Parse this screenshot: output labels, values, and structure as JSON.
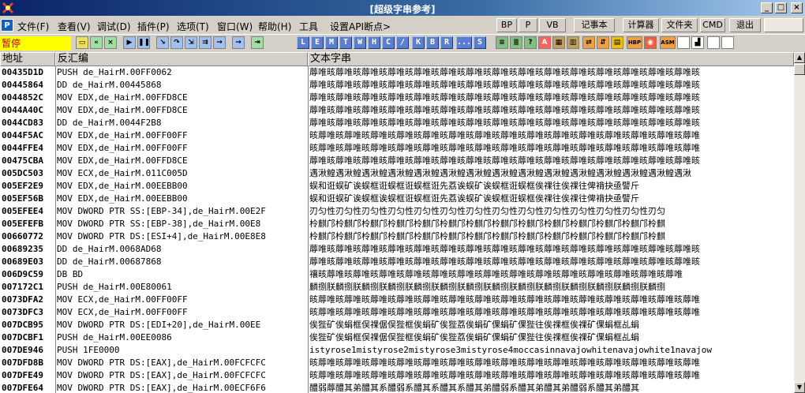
{
  "window": {
    "title": "[超级字串参考]",
    "minimize": "_",
    "maximize": "□",
    "close": "×"
  },
  "menu": {
    "items": [
      "文件(F)",
      "查看(V)",
      "调试(D)",
      "插件(P)",
      "选项(T)",
      "窗口(W)",
      "帮助(H)",
      "工具",
      "设置API断点>"
    ],
    "buttons": [
      "BP",
      "P",
      "VB",
      "记事本",
      "计算器",
      "文件夹",
      "CMD",
      "退出"
    ]
  },
  "toolbar": {
    "status": "暂停",
    "letters": [
      "L",
      "E",
      "M",
      "T",
      "W",
      "H",
      "C",
      "/",
      "K",
      "B",
      "R",
      "...",
      "S"
    ],
    "extra_labels": [
      "HBP",
      "ASM"
    ]
  },
  "table": {
    "headers": [
      "地址",
      "反汇编",
      "文本字串"
    ],
    "rows": [
      {
        "addr": "00435D1D",
        "dis": "PUSH de_HairM.00FF0062",
        "str": "蓐唯晐蓐唯晐蓐唯晐蓐唯晐蓐唯晐蓐唯晐蓐唯晐蓐唯晐蓐唯晐蓐唯晐蓐唯晐蓐唯晐蓐唯晐蓐唯晐蓐唯晐"
      },
      {
        "addr": "00445864",
        "dis": "DD de_HairM.00445868",
        "str": "蓐唯晐蓐唯晐蓐唯晐蓐唯晐蓐唯晐蓐唯晐蓐唯晐蓐唯晐蓐唯晐蓐唯晐蓐唯晐蓐唯晐蓐唯晐蓐唯晐蓐唯晐"
      },
      {
        "addr": "0044852C",
        "dis": "MOV EDX,de_HairM.00FFD8CE",
        "str": "蓐唯晐蓐唯晐蓐唯晐蓐唯晐蓐唯晐蓐唯晐蓐唯晐蓐唯晐蓐唯晐蓐唯晐蓐唯晐蓐唯晐蓐唯晐蓐唯晐蓐唯晐"
      },
      {
        "addr": "0044A40C",
        "dis": "MOV EDX,de_HairM.00FFD8CE",
        "str": "蓐唯晐蓐唯晐蓐唯晐蓐唯晐蓐唯晐蓐唯晐蓐唯晐蓐唯晐蓐唯晐蓐唯晐蓐唯晐蓐唯晐蓐唯晐蓐唯晐蓐唯晐"
      },
      {
        "addr": "0044CD83",
        "dis": "DD de_HairM.0044F2B8",
        "str": "蓐唯晐蓐唯晐蓐唯晐蓐唯晐蓐唯晐蓐唯晐蓐唯晐蓐唯晐蓐唯晐蓐唯晐蓐唯晐蓐唯晐蓐唯晐蓐唯晐蓐唯晐"
      },
      {
        "addr": "0044F5AC",
        "dis": "MOV EDX,de_HairM.00FF00FF",
        "str": "晐蓐唯晐蓐唯晐蓐唯晐蓐唯晐蓐唯晐蓐唯晐蓐唯晐蓐唯晐蓐唯晐蓐唯晐蓐唯晐蓐唯晐蓐唯晐蓐唯晐蓐唯"
      },
      {
        "addr": "0044FFE4",
        "dis": "MOV EDX,de_HairM.00FF00FF",
        "str": "晐蓐唯晐蓐唯晐蓐唯晐蓐唯晐蓐唯晐蓐唯晐蓐唯晐蓐唯晐蓐唯晐蓐唯晐蓐唯晐蓐唯晐蓐唯晐蓐唯晐蓐唯"
      },
      {
        "addr": "00475CBA",
        "dis": "MOV EDX,de_HairM.00FFD8CE",
        "str": "蓐唯晐蓐唯晐蓐唯晐蓐唯晐蓐唯晐蓐唯晐蓐唯晐蓐唯晐蓐唯晐蓐唯晐蓐唯晐蓐唯晐蓐唯晐蓐唯晐蓐唯晐"
      },
      {
        "addr": "005DC503",
        "dis": "MOV ECX,de_HairM.011C005D",
        "str": "遇湫鳇遇湫鳇遇湫鳇遇湫鳇遇湫鳇遇湫鳇遇湫鳇遇湫鳇遇湫鳇遇湫鳇遇湫鳇遇湫鳇遇湫鳇遇湫鳇遇湫"
      },
      {
        "addr": "005EF2E9",
        "dis": "MOV EDX,de_HairM.00EEBB00",
        "str": "蜈和诳蜈矿诶蜈框诳蜈框诳蜈框诳先荔诶蜈矿诶蜈框诳蜈框俟祼往俟祼往俾褙抉亟譬斤"
      },
      {
        "addr": "005EF56B",
        "dis": "MOV EDX,de_HairM.00EEBB00",
        "str": "蜈和诳蜈矿诶蜈框诶蜈框诳蜈框诳先荔诶蜈矿诶蜈框诳蜈框俟祼往俟祼往俾褙抉亟譬斤"
      },
      {
        "addr": "005EFEE4",
        "dis": "MOV DWORD PTR SS:[EBP-34],de_HairM.00E2F",
        "str": "刃匀性刃匀性刃匀性刃匀性刃匀性刃匀性刃匀性刃匀性刃匀性刃匀性刃匀性刃匀性刃匀性刃匀"
      },
      {
        "addr": "005EFEFB",
        "dis": "MOV DWORD PTR SS:[EBP-38],de_HairM.00E8",
        "str": "柃麒邝柃麒邝柃麒邝柃麒邝柃麒邝柃麒邝柃麒邝柃麒邝柃麒邝柃麒邝柃麒邝柃麒邝柃麒邝柃麒"
      },
      {
        "addr": "00660772",
        "dis": "MOV DWORD PTR DS:[ESI+4],de_HairM.00E8E8",
        "str": "柃麒邝柃麒邝柃麒邝柃麒邝柃麒邝柃麒邝柃麒邝柃麒邝柃麒邝柃麒邝柃麒邝柃麒邝柃麒邝柃麒"
      },
      {
        "addr": "00689235",
        "dis": "DD de_HairM.0068AD68",
        "str": "蓐唯晐蓐唯晐蓐唯晐蓐唯晐蓐唯晐蓐唯晐蓐唯晐蓐唯晐蓐唯晐蓐唯晐蓐唯晐蓐唯晐蓐唯晐蓐唯晐蓐唯晐"
      },
      {
        "addr": "00689E03",
        "dis": "DD de_HairM.00687868",
        "str": "蓐唯晐蓐唯晐蓐唯晐蓐唯晐蓐唯晐蓐唯晐蓐唯晐蓐唯晐蓐唯晐蓐唯晐蓐唯晐蓐唯晐蓐唯晐蓐唯晐蓐唯晐"
      },
      {
        "addr": "006D9C59",
        "dis": "DB BD",
        "str": "禳晐蓐唯晐蓐唯晐蓐唯晐蓐唯晐蓐唯晐蓐唯晐蓐唯晐蓐唯晐蓐唯晐蓐唯晐蓐唯晐蓐唯晐蓐唯晐蓐唯"
      },
      {
        "addr": "007172C1",
        "dis": "PUSH de_HairM.00E80061",
        "str": "麟捌朕麟捌朕麟捌朕麟捌朕麟捌朕麟捌朕麟捌朕麟捌朕麟捌朕麟捌朕麟捌朕麟捌朕麟捌朕麟捌"
      },
      {
        "addr": "0073DFA2",
        "dis": "MOV ECX,de_HairM.00FF00FF",
        "str": "晐蓐唯晐蓐唯晐蓐唯晐蓐唯晐蓐唯晐蓐唯晐蓐唯晐蓐唯晐蓐唯晐蓐唯晐蓐唯晐蓐唯晐蓐唯晐蓐唯晐蓐唯"
      },
      {
        "addr": "0073DFC3",
        "dis": "MOV ECX,de_HairM.00FF00FF",
        "str": "晐蓐唯晐蓐唯晐蓐唯晐蓐唯晐蓐唯晐蓐唯晐蓐唯晐蓐唯晐蓐唯晐蓐唯晐蓐唯晐蓐唯晐蓐唯晐蓐唯晐蓐唯"
      },
      {
        "addr": "007DCB95",
        "dis": "MOV DWORD PTR DS:[EDI+20],de_HairM.00EE",
        "str": "俟狴矿俟蜎框俣祼倨俣狴框俟蜎矿俟狴荔俟蜎矿倮蜎矿倮狴往俟祼框俟祼矿倮蜎框乩蜎"
      },
      {
        "addr": "007DCBF1",
        "dis": "PUSH de_HairM.00EE0086",
        "str": "俟狴矿俟蜎框俣祼倨俣狴框俟蜎矿俟狴荔俟蜎矿倮蜎矿倮狴往俟祼框俟祼矿倮蜎框乩蜎"
      },
      {
        "addr": "007DE946",
        "dis": "PUSH 1FE0000",
        "str": "istyrose1mistyrose2mistyrose3mistyrose4moccasinnavajowhitenavajowhite1navajow"
      },
      {
        "addr": "007DFD8B",
        "dis": "MOV DWORD PTR DS:[EAX],de_HairM.00FCFCFC",
        "str": "晐蓐唯晐蓐唯晐蓐唯晐蓐唯晐蓐唯晐蓐唯晐蓐唯晐蓐唯晐蓐唯晐蓐唯晐蓐唯晐蓐唯晐蓐唯晐蓐唯晐蓐唯"
      },
      {
        "addr": "007DFE49",
        "dis": "MOV DWORD PTR DS:[EAX],de_HairM.00FCFCFC",
        "str": "晐蓐唯晐蓐唯晐蓐唯晐蓐唯晐蓐唯晐蓐唯晐蓐唯晐蓐唯晐蓐唯晐蓐唯晐蓐唯晐蓐唯晐蓐唯晐蓐唯晐蓐唯"
      },
      {
        "addr": "007DFE64",
        "dis": "MOV DWORD PTR DS:[EAX],de_HairM.00ECF6F6",
        "str": "醴弱蓐醴其弟醴其系醴弱系醴其系醴其系醴其弟醴弱系醴其弟醴其弟醴弱系醴其弟醴其"
      }
    ]
  },
  "colors": {
    "status_bg": "#ffff00",
    "status_text": "#c00000",
    "titlebar": "#0a246a"
  }
}
